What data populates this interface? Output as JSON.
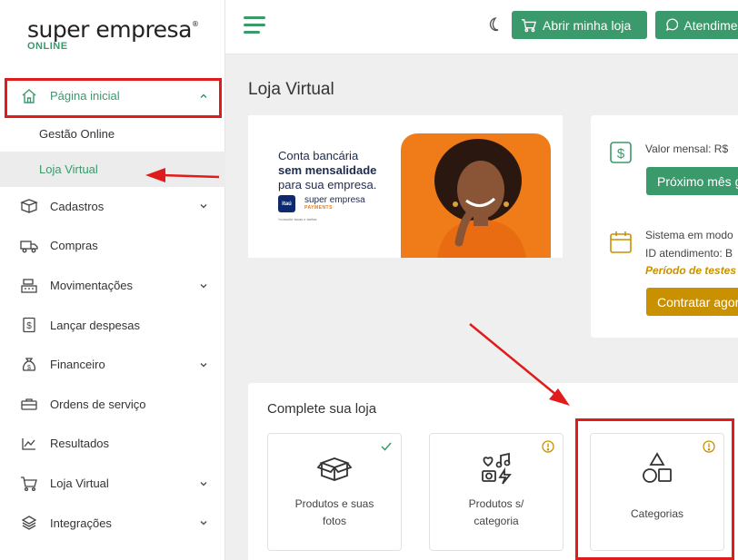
{
  "brand": {
    "name": "super empresa",
    "reg": "®",
    "sub": "ONLINE"
  },
  "sidebar": {
    "items": [
      {
        "label": "Página inicial",
        "icon": "home-icon",
        "active": true
      },
      {
        "label": "Cadastros",
        "icon": "box-icon"
      },
      {
        "label": "Compras",
        "icon": "truck-icon"
      },
      {
        "label": "Movimentações",
        "icon": "register-icon"
      },
      {
        "label": "Lançar despesas",
        "icon": "dollar-receipt-icon"
      },
      {
        "label": "Financeiro",
        "icon": "money-bag-icon"
      },
      {
        "label": "Ordens de serviço",
        "icon": "toolbox-icon"
      },
      {
        "label": "Resultados",
        "icon": "line-chart-icon"
      },
      {
        "label": "Loja Virtual",
        "icon": "cart-icon"
      },
      {
        "label": "Integrações",
        "icon": "layers-icon"
      }
    ],
    "subitems": [
      {
        "label": "Gestão Online"
      },
      {
        "label": "Loja Virtual",
        "selected": true
      }
    ]
  },
  "topbar": {
    "store_button": "Abrir minha loja",
    "help_button": "Atendimento"
  },
  "main": {
    "page_title": "Loja Virtual",
    "banner": {
      "line1": "Conta bancária",
      "line2": "sem mensalidade",
      "line3": "para sua empresa.",
      "bank": "itaú",
      "partner": "super empresa",
      "partner_sub": "PAYMENTS",
      "footnote": "*consulte taxas e tarifas"
    },
    "info": {
      "monthly_label": "Valor mensal: R$",
      "next_month_button": "Próximo mês g",
      "mode_label": "Sistema em modo",
      "ticket_label": "ID atendimento: B",
      "trial_label": "Período de testes",
      "contract_button": "Contratar agor"
    },
    "complete": {
      "title": "Complete sua loja",
      "tiles": [
        {
          "label": "Produtos e suas fotos",
          "status": "done",
          "icon": "open-box-icon"
        },
        {
          "label": "Produtos s/ categoria",
          "status": "warning",
          "icon": "media-icons-icon"
        },
        {
          "label": "Categorias",
          "status": "warning",
          "icon": "shapes-icon"
        }
      ]
    }
  },
  "colors": {
    "accent": "#3a9a6b",
    "warning": "#c99100",
    "annotation": "#e01b1b"
  }
}
